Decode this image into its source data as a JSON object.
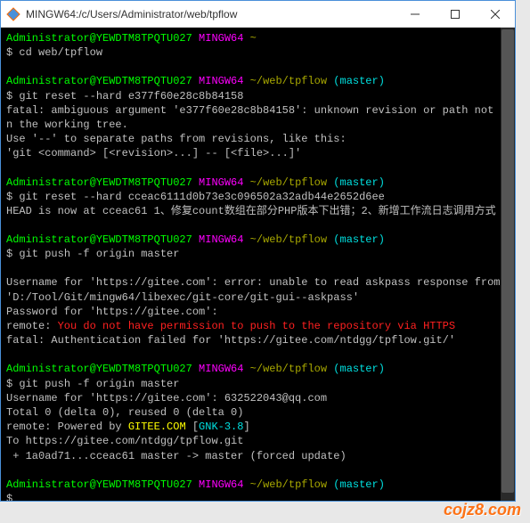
{
  "titlebar": {
    "title": "MINGW64:/c/Users/Administrator/web/tpflow"
  },
  "watermark": "cojz8.com",
  "prompt": {
    "user": "Administrator@YEWDTM8TPQTU027",
    "shell": "MINGW64",
    "home_path": "~",
    "path": "~/web/tpflow",
    "branch_open": "(",
    "branch": "master",
    "branch_close": ")",
    "prompt_char": "$ "
  },
  "cmd1": "cd web/tpflow",
  "cmd2": "git reset --hard e377f60e28c8b84158",
  "out2a": "fatal: ambiguous argument 'e377f60e28c8b84158': unknown revision or path not in the working tree.",
  "out2b": "Use '--' to separate paths from revisions, like this:",
  "out2c": "'git <command> [<revision>...] -- [<file>...]'",
  "cmd3": "git reset --hard cceac6111d0b73e3c096502a32adb44e2652d6ee",
  "out3": "HEAD is now at cceac61 1、修复count数组在部分PHP版本下出错；2、新增工作流日志调用方式",
  "cmd4": "git push -f origin master",
  "out4a": "Username for 'https://gitee.com': error: unable to read askpass response from 'D:/Tool/Git/mingw64/libexec/git-core/git-gui--askpass'",
  "out4b": "Password for 'https://gitee.com':",
  "out4c_prefix": "remote: ",
  "out4c_err": "You do not have permission to push to the repository via HTTPS",
  "out4d": "fatal: Authentication failed for 'https://gitee.com/ntdgg/tpflow.git/'",
  "cmd5": "git push -f origin master",
  "out5a": "Username for 'https://gitee.com': 632522043@qq.com",
  "out5b": "Total 0 (delta 0), reused 0 (delta 0)",
  "out5c_prefix": "remote: Powered by ",
  "out5c_site": "GITEE.COM",
  "out5c_suffix": " [",
  "out5c_ver": "GNK-3.8",
  "out5c_close": "]",
  "out5d": "To https://gitee.com/ntdgg/tpflow.git",
  "out5e": " + 1a0ad71...cceac61 master -> master (forced update)"
}
